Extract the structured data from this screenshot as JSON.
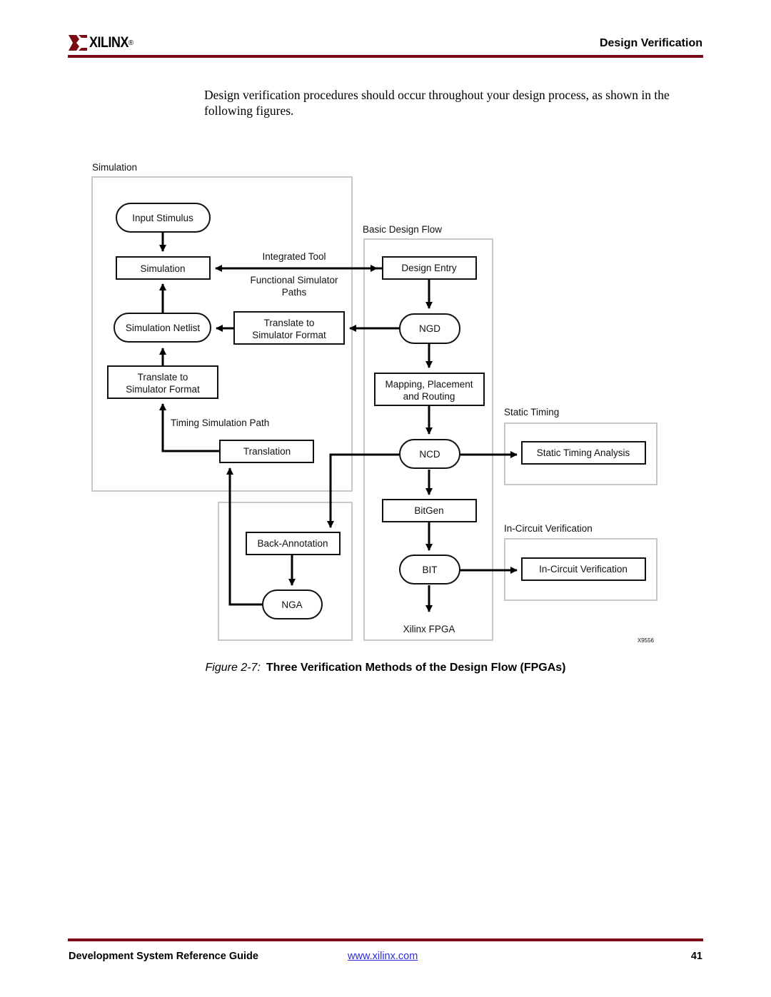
{
  "header": {
    "logo_text": "XILINX",
    "logo_mark": "®",
    "section_title": "Design Verification",
    "brand_color": "#7a0a14"
  },
  "intro_text": "Design verification procedures should occur throughout your design process, as shown in the following figures.",
  "diagram": {
    "groups": {
      "simulation": "Simulation",
      "basic_flow": "Basic Design Flow",
      "static_timing": "Static Timing",
      "in_circuit": "In-Circuit Verification"
    },
    "nodes": {
      "input_stimulus": "Input Stimulus",
      "simulation": "Simulation",
      "simulation_netlist": "Simulation Netlist",
      "translate_sim_1_line1": "Translate to",
      "translate_sim_1_line2": "Simulator Format",
      "translate_sim_2_line1": "Translate to",
      "translate_sim_2_line2": "Simulator Format",
      "translation": "Translation",
      "back_annotation": "Back-Annotation",
      "nga": "NGA",
      "design_entry": "Design Entry",
      "ngd": "NGD",
      "mpr_line1": "Mapping, Placement",
      "mpr_line2": "and Routing",
      "ncd": "NCD",
      "bitgen": "BitGen",
      "bit": "BIT",
      "xilinx_fpga": "Xilinx FPGA",
      "static_timing_analysis": "Static Timing Analysis",
      "in_circuit_verification": "In-Circuit Verification"
    },
    "edge_labels": {
      "integrated_tool": "Integrated Tool",
      "functional_line1": "Functional Simulator",
      "functional_line2": "Paths",
      "timing_path": "Timing Simulation Path"
    },
    "figure_id": "X9556"
  },
  "caption": {
    "number": "Figure 2-7:",
    "title": "Three Verification Methods of the Design Flow (FPGAs)"
  },
  "footer": {
    "doc_title": "Development System Reference Guide",
    "link": "www.xilinx.com",
    "page_number": "41"
  }
}
